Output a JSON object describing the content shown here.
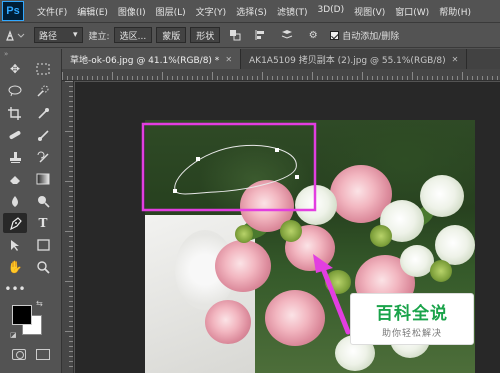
{
  "app": {
    "logo": "Ps"
  },
  "menu": [
    "文件(F)",
    "编辑(E)",
    "图像(I)",
    "图层(L)",
    "文字(Y)",
    "选择(S)",
    "滤镜(T)",
    "3D(D)",
    "视图(V)",
    "窗口(W)",
    "帮助(H)"
  ],
  "options": {
    "tool_icon": "pen-icon",
    "mode_select": "路径",
    "build_label": "建立:",
    "selection_btn": "选区...",
    "mask_btn": "蒙版",
    "shape_btn": "形状",
    "auto_add_delete_checked": true,
    "auto_add_delete_label": "自动添加/删除"
  },
  "tabs": [
    {
      "label": "草地-ok-06.jpg @ 41.1%(RGB/8) *",
      "active": true
    },
    {
      "label": "AK1A5109 拷贝副本 (2).jpg @ 55.1%(RGB/8)",
      "active": false
    }
  ],
  "tools": [
    "move-icon",
    "marquee-icon",
    "lasso-icon",
    "quick-select-icon",
    "crop-icon",
    "eyedropper-icon",
    "healing-brush-icon",
    "brush-icon",
    "clone-stamp-icon",
    "history-brush-icon",
    "eraser-icon",
    "gradient-icon",
    "blur-icon",
    "dodge-icon",
    "pen-icon",
    "type-icon",
    "path-select-icon",
    "rectangle-icon",
    "hand-icon",
    "zoom-icon"
  ],
  "colors": {
    "foreground": "#000000",
    "background": "#ffffff",
    "annotation": "#e23ee0"
  },
  "watermark": {
    "title": "百科全说",
    "subtitle": "助你轻松解决"
  }
}
